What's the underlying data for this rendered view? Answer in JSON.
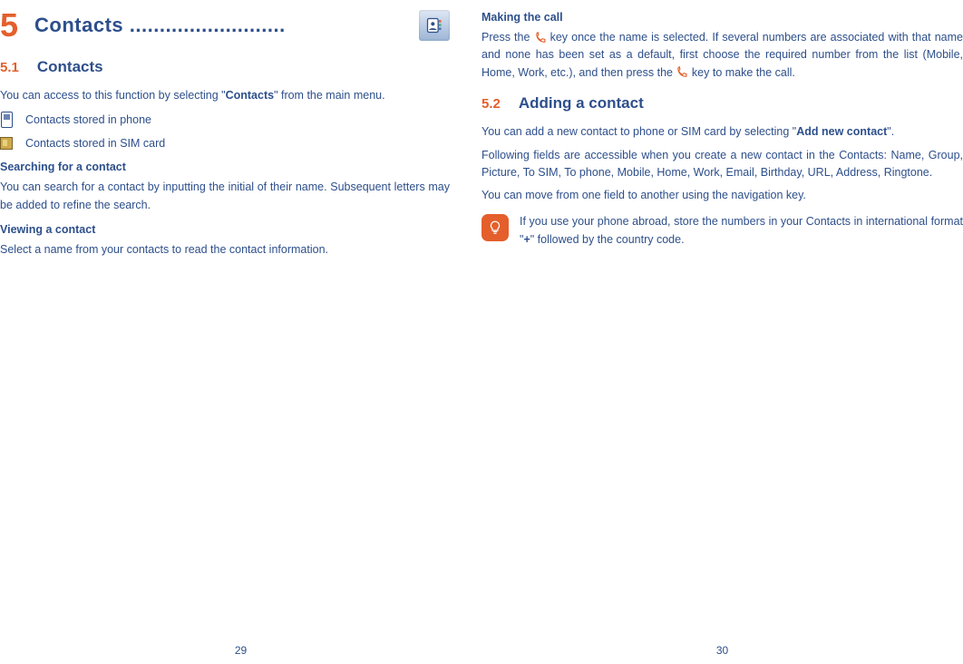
{
  "left": {
    "chapter_num": "5",
    "chapter_title": "Contacts ..........................",
    "sec1_num": "5.1",
    "sec1_title": "Contacts",
    "intro_a": "You can access to this function by selecting \"",
    "intro_bold": "Contacts",
    "intro_b": "\" from the main menu.",
    "row_phone": "Contacts stored in phone",
    "row_sim": "Contacts stored in SIM card",
    "sub_search": "Searching for a contact",
    "search_body": "You can search for a contact by inputting the initial of their name. Subsequent letters may be added to refine the search.",
    "sub_view": "Viewing a contact",
    "view_body": "Select a name from your contacts to read the contact information.",
    "page_num": "29"
  },
  "right": {
    "sub_make": "Making the call",
    "make_a": "Press the ",
    "make_b": " key once the name is selected. If several numbers are associated with that name and none has been set as a default, first choose the required number from the list (Mobile, Home, Work, etc.), and then press the ",
    "make_c": " key to make the call.",
    "sec2_num": "5.2",
    "sec2_title": "Adding a contact",
    "add_a": "You can add a new contact to phone or SIM card by selecting \"",
    "add_bold": "Add new contact",
    "add_b": "\".",
    "fields_body": "Following fields are accessible when you create a new contact in the Contacts: Name, Group, Picture, To SIM, To phone, Mobile, Home, Work, Email, Birthday, URL, Address, Ringtone.",
    "nav_body": "You can move from one field to another using the navigation key.",
    "tip_a": "If you use your phone abroad, store the numbers in your Contacts in international format \"",
    "tip_bold": "+",
    "tip_b": "\" followed by the country code.",
    "page_num": "30"
  }
}
